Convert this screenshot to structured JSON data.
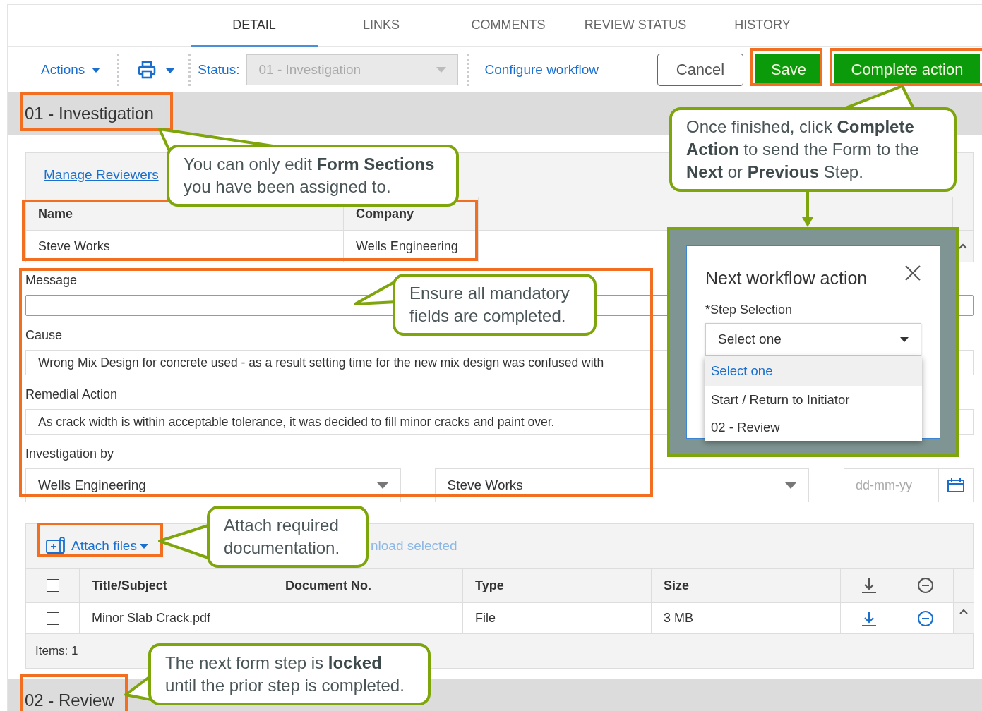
{
  "tabs": [
    {
      "label": "DETAIL",
      "selected": true
    },
    {
      "label": "LINKS",
      "selected": false
    },
    {
      "label": "COMMENTS",
      "selected": false
    },
    {
      "label": "REVIEW STATUS",
      "selected": false
    },
    {
      "label": "HISTORY",
      "selected": false
    }
  ],
  "toolbar": {
    "actions": "Actions",
    "status_label": "Status:",
    "status": {
      "value": "01 - Investigation",
      "disabled": true
    },
    "configure": "Configure workflow",
    "buttons": [
      {
        "label": "Cancel",
        "kind": "secondary"
      },
      {
        "label": "Save",
        "kind": "primary"
      },
      {
        "label": "Complete action",
        "kind": "primary"
      }
    ]
  },
  "section": {
    "title": "01 - Investigation"
  },
  "reviewers": {
    "link": "Manage Reviewers",
    "columns": [
      "Name",
      "Company"
    ],
    "rows": [
      {
        "name": "Steve Works",
        "company": "Wells Engineering"
      }
    ]
  },
  "form": {
    "fields": [
      {
        "label": "Message"
      },
      {
        "label": "Cause",
        "value": "Wrong Mix Design for concrete used - as a result setting time for the new mix design was confused with"
      },
      {
        "label": "Remedial Action",
        "value": "As crack width is within acceptable tolerance, it was decided to fill minor cracks and paint over."
      }
    ],
    "investigation": {
      "label": "Investigation by",
      "company": "Wells Engineering",
      "person": "Steve Works",
      "date_placeholder": "dd-mm-yy"
    }
  },
  "attachments": {
    "attach": "Attach files",
    "download": "nload selected",
    "header_checked": false,
    "columns": [
      "Title/Subject",
      "Document No.",
      "Type",
      "Size"
    ],
    "rows": [
      {
        "checked": false,
        "title": "Minor Slab Crack.pdf",
        "type": "File",
        "size": "3 MB"
      }
    ],
    "footer": "Items: 1"
  },
  "next_section": {
    "title": "02 - Review"
  },
  "dialog": {
    "title": "Next workflow action",
    "label": "*Step Selection",
    "value": "Select one",
    "options": [
      {
        "label": "Select one",
        "selected": true
      },
      {
        "label": "Start / Return to Initiator",
        "selected": false
      },
      {
        "label": "02 - Review",
        "selected": false
      }
    ]
  },
  "callouts": [
    {
      "text": "You can only edit **Form Sections** you have been assigned to."
    },
    {
      "text": "Once finished, click **Complete Action** to send the Form to the **Next** or **Previous** Step."
    },
    {
      "text": "Ensure all mandatory fields are completed."
    },
    {
      "text": "Attach required documentation."
    },
    {
      "text": "The next form step is **locked** until the prior step is completed."
    }
  ]
}
